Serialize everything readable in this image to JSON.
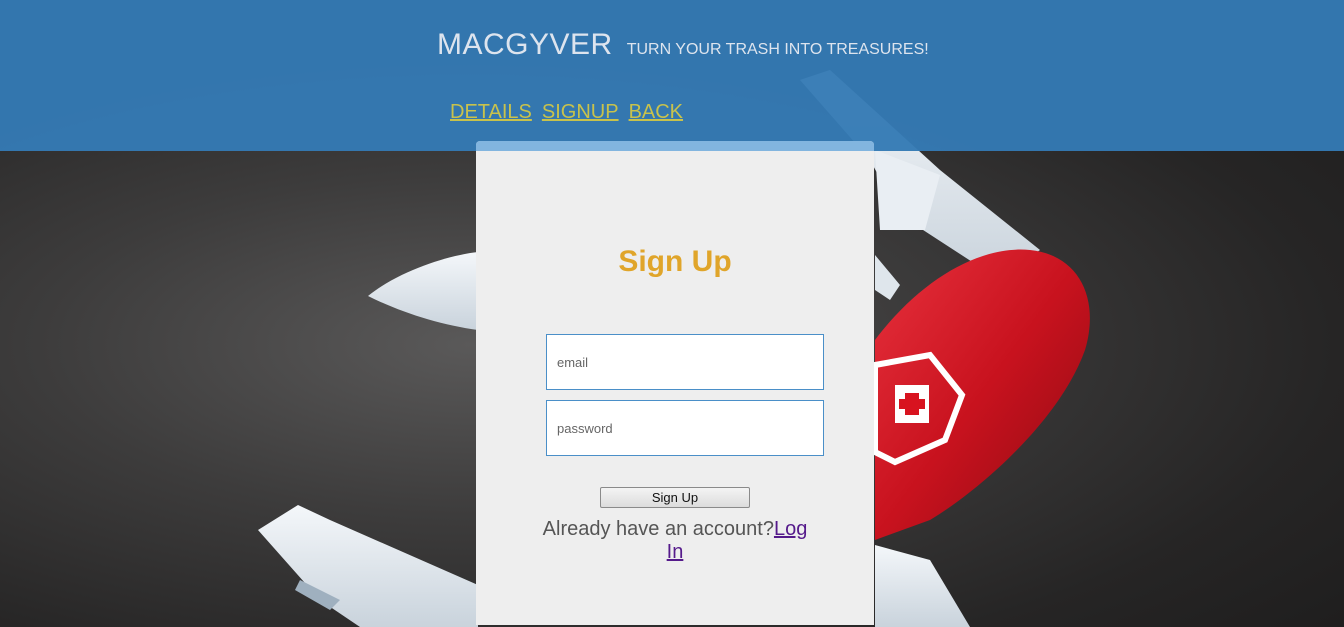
{
  "header": {
    "title": "MACGYVER",
    "tagline": "TURN YOUR TRASH INTO TREASURES!",
    "background_color": "#347ab4",
    "nav": [
      {
        "label": "DETAILS"
      },
      {
        "label": "SIGNUP"
      },
      {
        "label": "BACK"
      }
    ],
    "nav_color": "#c8c24c"
  },
  "card": {
    "title": "Sign Up",
    "title_color": "#e0a52a",
    "email_placeholder": "email",
    "password_placeholder": "password",
    "submit_label": "Sign Up",
    "account_prompt": "Already have an account?",
    "login_link": "Log In"
  },
  "background": {
    "illustration": "swiss-army-knife"
  }
}
